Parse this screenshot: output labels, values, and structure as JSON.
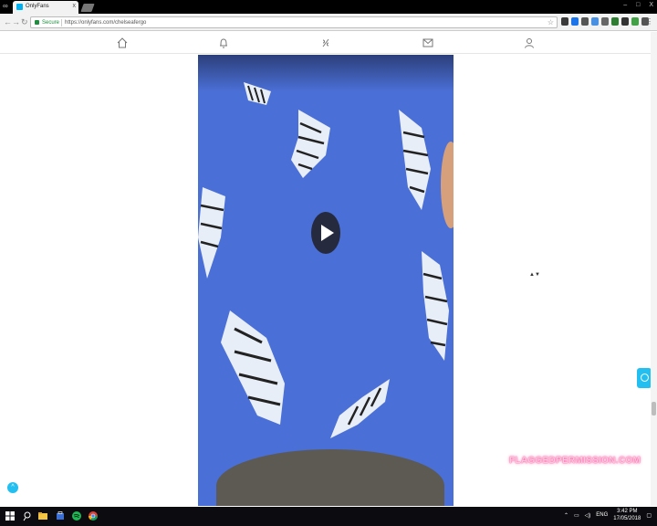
{
  "browser": {
    "tab_title": "OnlyFans",
    "tab_close": "x",
    "window_controls": [
      "–",
      "□",
      "X"
    ],
    "address": {
      "secure_label": "Secure",
      "url": "https://onlyfans.com/chelseafergo"
    },
    "back_icon": "←",
    "forward_icon": "→",
    "reload_icon": "↻",
    "star_icon": "☆",
    "menu_icon": "⋮",
    "extension_colors": [
      "#3a3a3a",
      "#1a73e8",
      "#555555",
      "#4a90e2",
      "#666666",
      "#2e7d32",
      "#333333",
      "#43a047",
      "#555555"
    ]
  },
  "site_nav": {
    "items": [
      "home-icon",
      "notifications-icon",
      "discover-icon",
      "messages-icon",
      "profile-icon"
    ]
  },
  "video": {
    "play_icon": "play-icon",
    "background_color": "#4a6fd6"
  },
  "page": {
    "watermark": "FLAGGEDPERMISSION.COM",
    "scroll_top_icon": "^",
    "scroll_caret": "▲▼"
  },
  "taskbar": {
    "language": "ENG",
    "time": "3:42 PM",
    "date": "17/05/2018"
  }
}
